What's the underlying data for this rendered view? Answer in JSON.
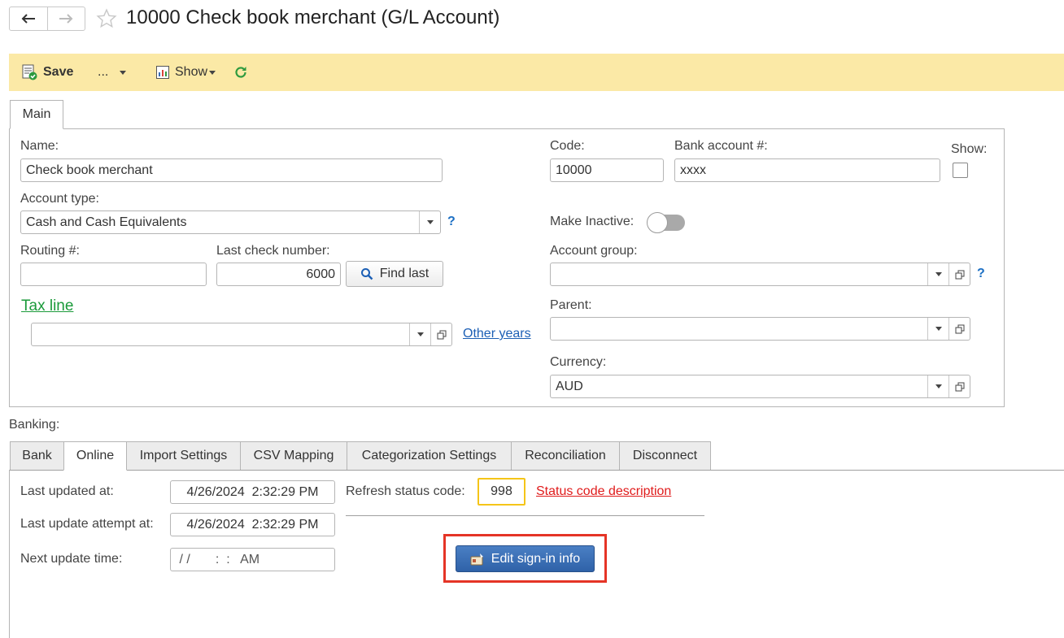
{
  "window": {
    "title": "10000 Check book merchant (G/L Account)"
  },
  "toolbar": {
    "save_label": "Save",
    "more_label": "...",
    "show_label": "Show",
    "accent_color": "#fbe9a6",
    "refresh_icon": "refresh-icon"
  },
  "main_tab": {
    "label": "Main"
  },
  "form": {
    "name_label": "Name:",
    "name_value": "Check book merchant",
    "code_label": "Code:",
    "code_value": "10000",
    "bank_account_label": "Bank account #:",
    "bank_account_value": "xxxx",
    "show_label": "Show:",
    "account_type_label": "Account type:",
    "account_type_value": "Cash and Cash Equivalents",
    "help_mark": "?",
    "make_inactive_label": "Make Inactive:",
    "routing_label": "Routing #:",
    "routing_value": "",
    "last_check_label": "Last check number:",
    "last_check_value": "6000",
    "find_last_label": "Find last",
    "account_group_label": "Account group:",
    "account_group_value": "",
    "tax_line_label": "Tax line",
    "tax_line_value": "",
    "other_years_label": "Other years",
    "parent_label": "Parent:",
    "parent_value": "",
    "currency_label": "Currency:",
    "currency_value": "AUD"
  },
  "banking": {
    "section_label": "Banking:",
    "tabs": [
      {
        "label": "Bank"
      },
      {
        "label": "Online"
      },
      {
        "label": "Import Settings"
      },
      {
        "label": "CSV Mapping"
      },
      {
        "label": "Categorization Settings"
      },
      {
        "label": "Reconciliation"
      },
      {
        "label": "Disconnect"
      }
    ],
    "active_tab": "Online",
    "online": {
      "last_updated_label": "Last updated at:",
      "last_updated_value": "4/26/2024  2:32:29 PM",
      "last_attempt_label": "Last update attempt at:",
      "last_attempt_value": "4/26/2024  2:32:29 PM",
      "next_update_label": "Next update time:",
      "next_update_value": " / /       :  :   AM",
      "refresh_status_label": "Refresh status code:",
      "refresh_status_value": "998",
      "status_desc_link": "Status code description",
      "edit_signin_label": "Edit sign-in info"
    }
  },
  "colors": {
    "link_green": "#1a9a3a",
    "link_blue": "#1c5fb5",
    "link_red": "#e01b1b",
    "highlight_yellow": "#f5c518",
    "highlight_red": "#e53426",
    "primary_button": "#3a6db3"
  }
}
